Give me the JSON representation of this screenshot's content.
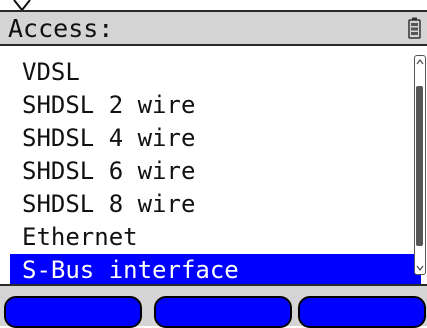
{
  "header": {
    "title": "Access:",
    "battery_icon": "battery-icon"
  },
  "menu": {
    "items": [
      {
        "label": "VDSL",
        "selected": false
      },
      {
        "label": "SHDSL 2 wire",
        "selected": false
      },
      {
        "label": "SHDSL 4 wire",
        "selected": false
      },
      {
        "label": "SHDSL 6 wire",
        "selected": false
      },
      {
        "label": "SHDSL 8 wire",
        "selected": false
      },
      {
        "label": "Ethernet",
        "selected": false
      },
      {
        "label": "S-Bus interface",
        "selected": true
      }
    ]
  },
  "softkeys": {
    "left": "",
    "middle": "",
    "right": ""
  },
  "colors": {
    "selection": "#0000ff",
    "bar_background": "#d4d4d4",
    "text": "#111111"
  }
}
